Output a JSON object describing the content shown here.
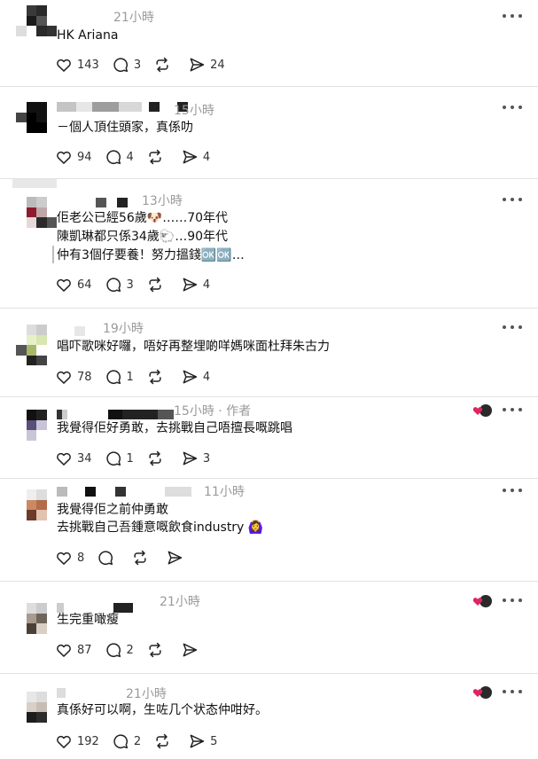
{
  "comments": [
    {
      "time": "21小時",
      "text": "HK Ariana",
      "likes": "143",
      "replies": "3",
      "reposts": "",
      "shares": "24"
    },
    {
      "time": "15小時",
      "text": "－個人頂住頭家，真係叻",
      "likes": "94",
      "replies": "4",
      "reposts": "",
      "shares": "4"
    },
    {
      "time": "13小時",
      "lines": [
        "佢老公已經56歲🐶……70年代",
        "陳凱琳都只係34歲🐑…90年代",
        "仲有3個仔要養！努力搵錢🆗🆗…"
      ],
      "likes": "64",
      "replies": "3",
      "reposts": "",
      "shares": "4"
    },
    {
      "time": "19小時",
      "text": "唱吓歌咪好囉，唔好再整埋啲咩媽咪面杜拜朱古力",
      "likes": "78",
      "replies": "1",
      "reposts": "",
      "shares": "4"
    },
    {
      "time": "15小時 · 作者",
      "text": "我覺得佢好勇敢，去挑戰自己唔擅長嘅跳唱",
      "likes": "34",
      "replies": "1",
      "reposts": "",
      "shares": "3"
    },
    {
      "time": "11小時",
      "lines": [
        "我覺得佢之前仲勇敢",
        "去挑戰自己吾鍾意嘅飲食industry 🙆‍♀️"
      ],
      "likes": "8",
      "replies": "",
      "reposts": "",
      "shares": ""
    },
    {
      "time": "21小時",
      "text": "生完重噉瘦",
      "likes": "87",
      "replies": "2",
      "reposts": "",
      "shares": ""
    },
    {
      "time": "21小時",
      "text": "真係好可以啊，生咗几个状态仲咁好。",
      "likes": "192",
      "replies": "2",
      "reposts": "",
      "shares": "5"
    }
  ],
  "colors": {
    "badge_heart": "#e0245e",
    "text": "#101010",
    "muted": "#9a9a9a",
    "divider": "#e2e2e2"
  },
  "icons": [
    "heart-icon",
    "reply-icon",
    "repost-icon",
    "share-icon",
    "more-icon"
  ]
}
